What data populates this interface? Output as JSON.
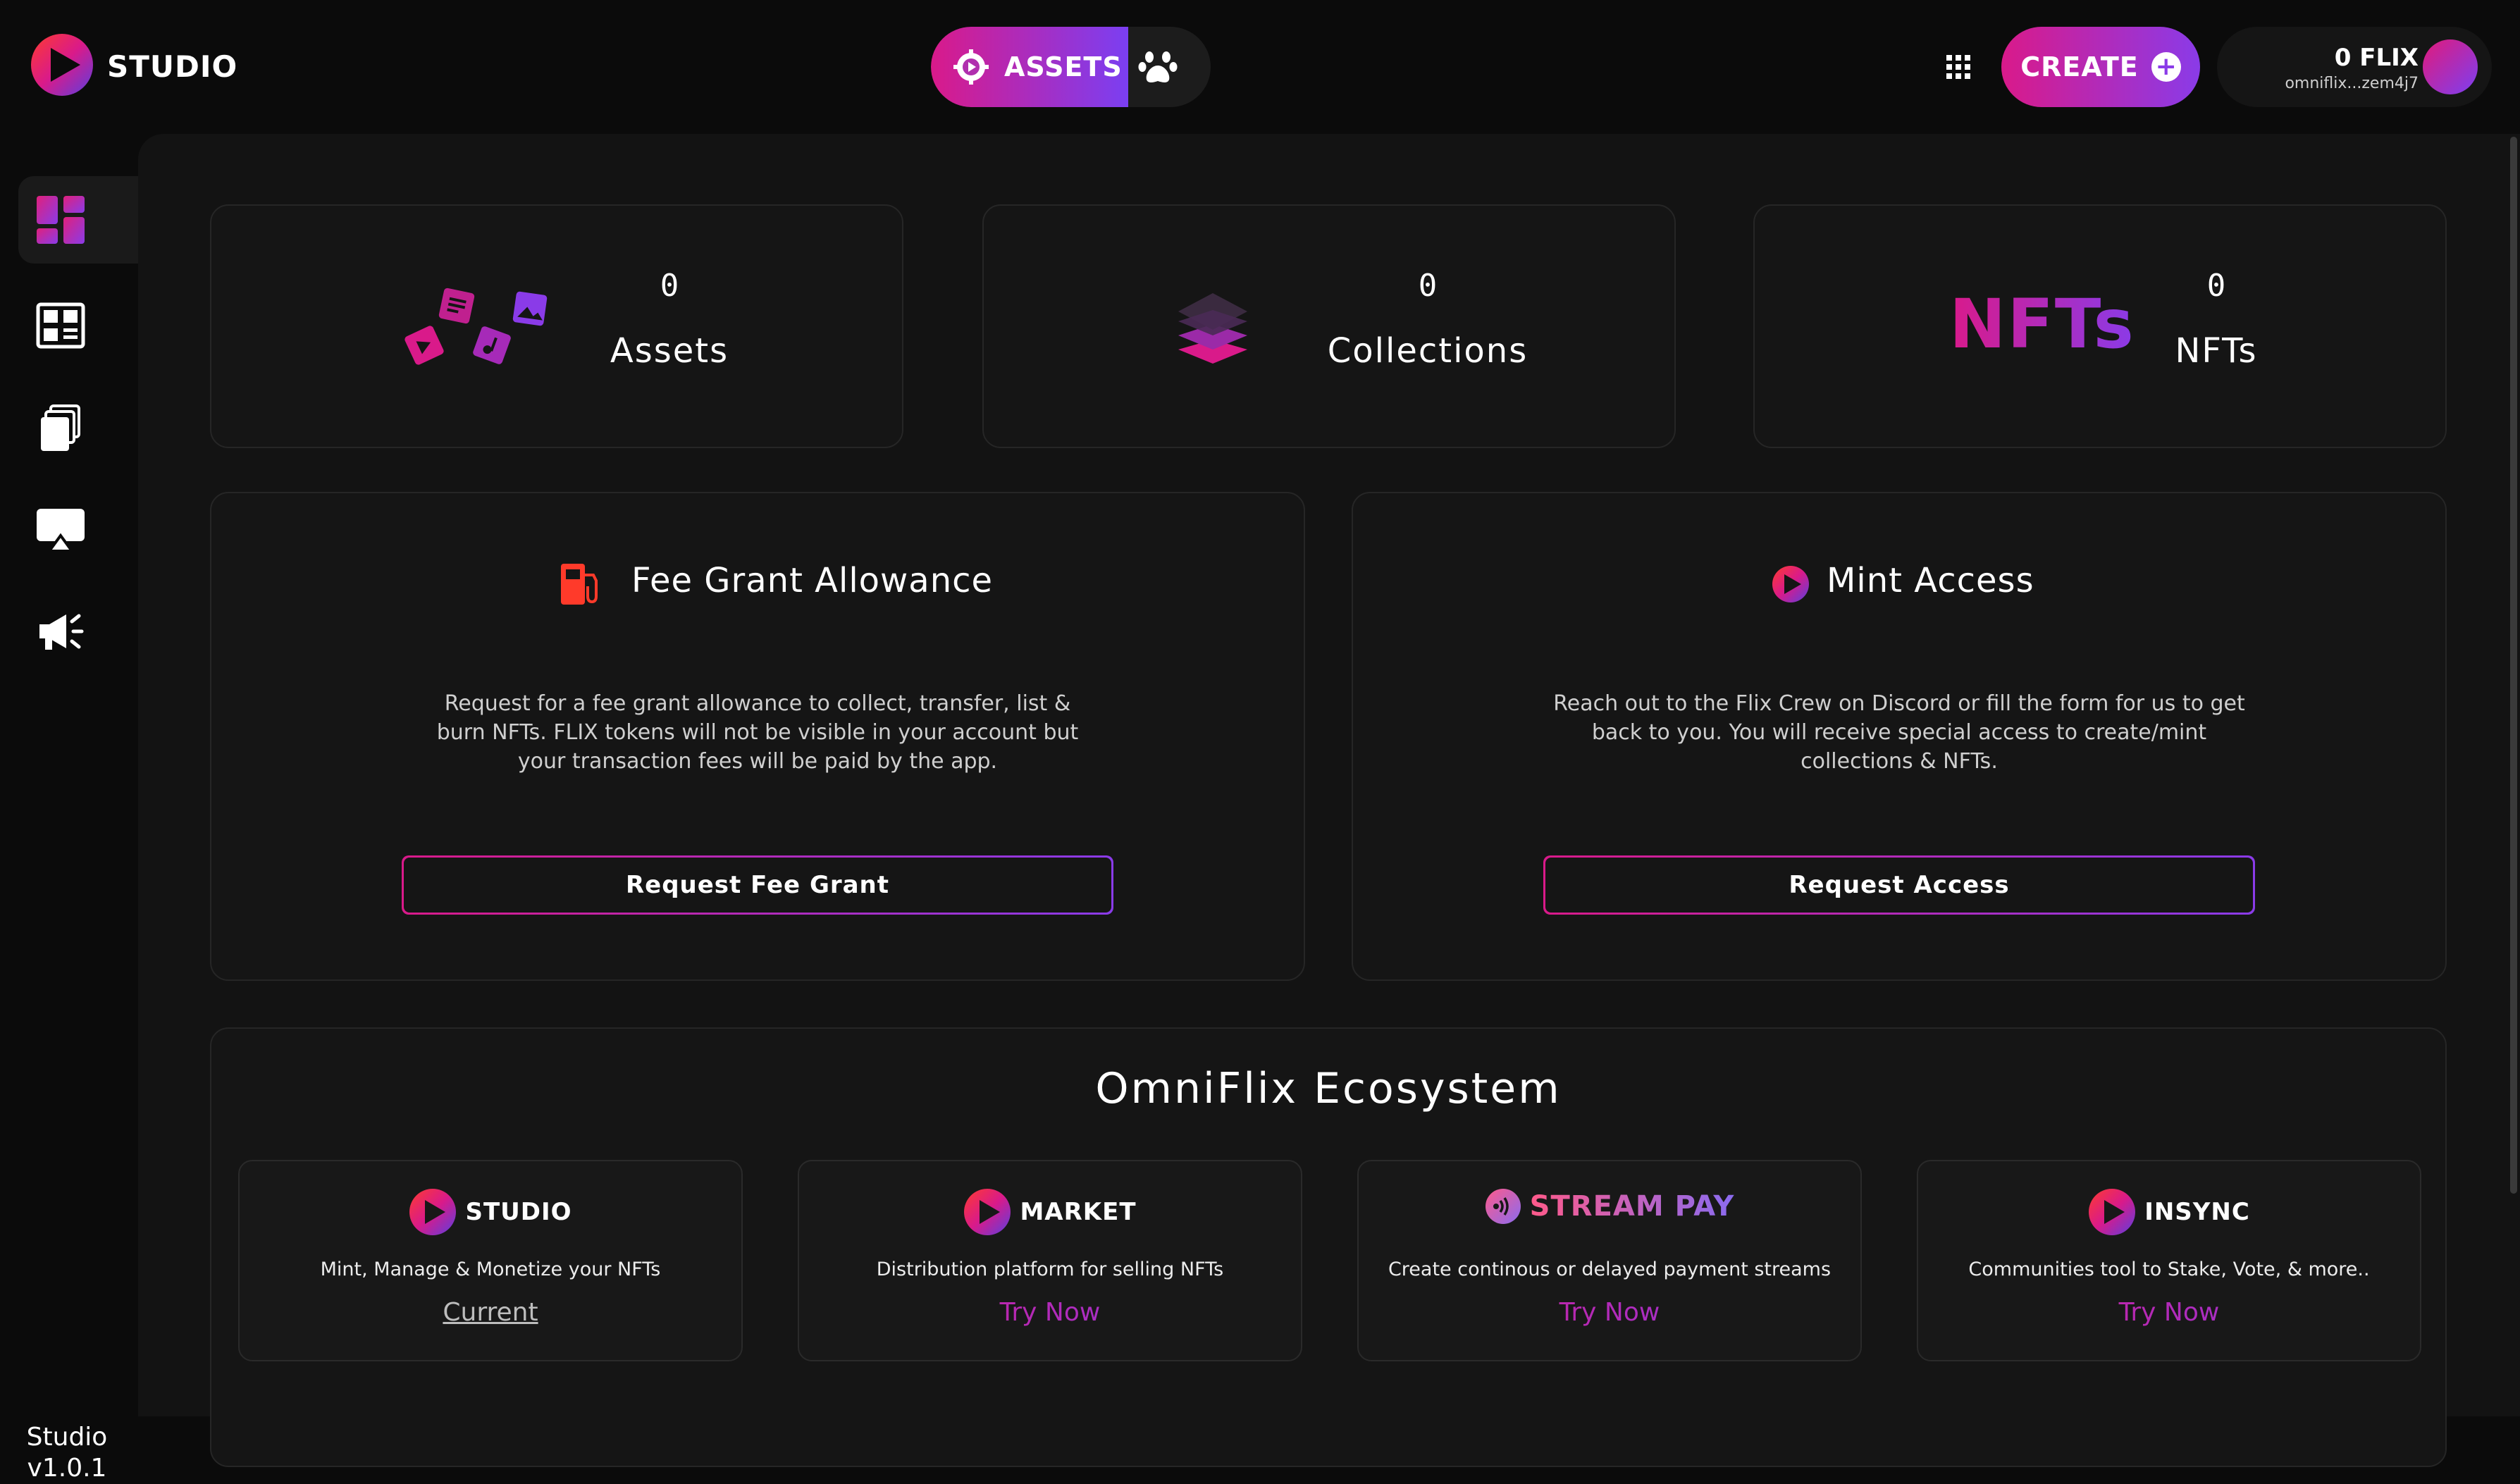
{
  "header": {
    "brand": "STUDIO",
    "nav": {
      "assets_label": "ASSETS"
    },
    "create_label": "CREATE",
    "wallet": {
      "balance": "0 FLIX",
      "address": "omniflix...zem4j7"
    }
  },
  "sidebar": {
    "items": [
      {
        "icon": "dashboard-icon",
        "active": true
      },
      {
        "icon": "library-icon",
        "active": false
      },
      {
        "icon": "collections-icon",
        "active": false
      },
      {
        "icon": "stream-icon",
        "active": false
      },
      {
        "icon": "megaphone-icon",
        "active": false
      }
    ],
    "version_name": "Studio",
    "version_number": "v1.0.1"
  },
  "stats": [
    {
      "value": "0",
      "label": "Assets"
    },
    {
      "value": "0",
      "label": "Collections"
    },
    {
      "value": "0",
      "label": "NFTs",
      "logo_text": "NFTs"
    }
  ],
  "fee_grant": {
    "title": "Fee Grant Allowance",
    "description": "Request for a fee grant allowance to collect, transfer, list & burn NFTs. FLIX tokens will not be visible in your account but your transaction fees will be paid by the app.",
    "button": "Request Fee Grant"
  },
  "mint_access": {
    "title": "Mint Access",
    "description": "Reach out to the Flix Crew on Discord or fill the form for us to get back to you. You will receive special access to create/mint collections & NFTs.",
    "button": "Request Access"
  },
  "ecosystem": {
    "title": "OmniFlix Ecosystem",
    "apps": [
      {
        "name": "STUDIO",
        "description": "Mint, Manage & Monetize your NFTs",
        "link": "Current"
      },
      {
        "name": "MARKET",
        "description": "Distribution platform for selling NFTs",
        "link": "Try Now"
      },
      {
        "name": "STREAM PAY",
        "description": "Create continous or delayed payment streams",
        "link": "Try Now"
      },
      {
        "name": "INSYNC",
        "description": "Communities tool to Stake, Vote, & more..",
        "link": "Try Now"
      }
    ]
  },
  "colors": {
    "accent_pink": "#d91a8a",
    "accent_purple": "#8a3be8",
    "background": "#0b0b0b",
    "card": "#151515"
  }
}
